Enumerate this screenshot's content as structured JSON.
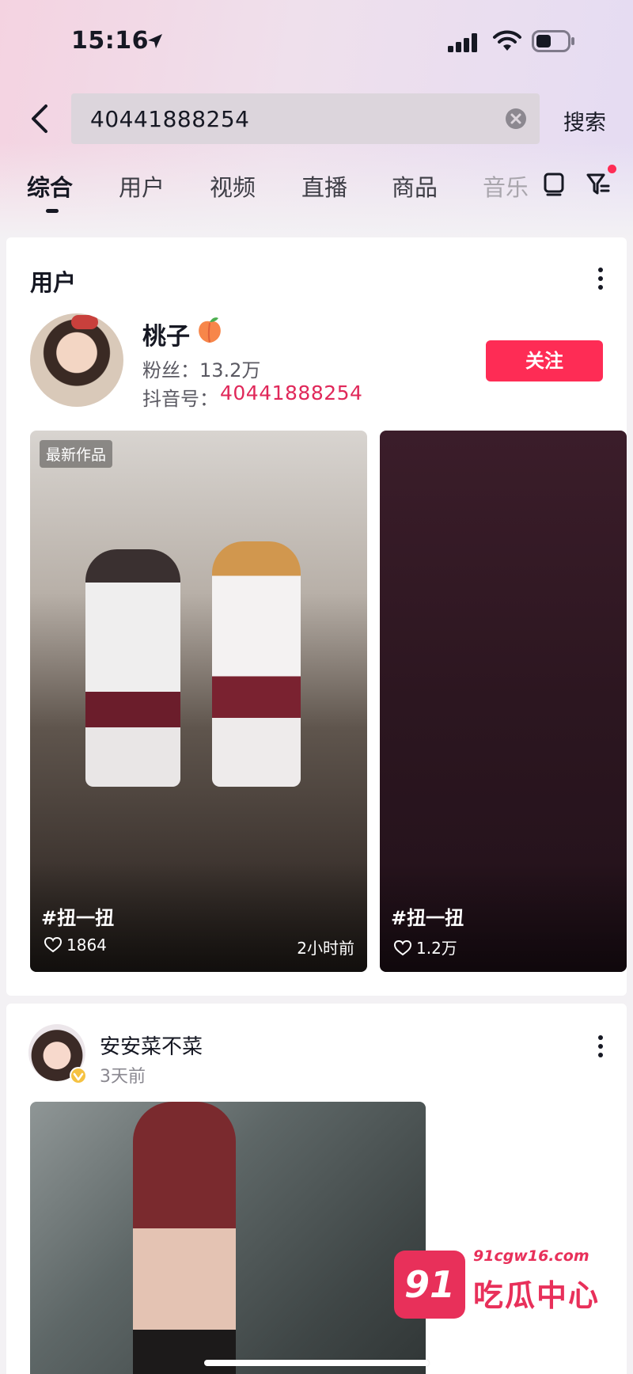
{
  "status_bar": {
    "time": "15:16"
  },
  "search": {
    "query": "40441888254",
    "submit_label": "搜索"
  },
  "tabs": [
    {
      "label": "综合"
    },
    {
      "label": "用户"
    },
    {
      "label": "视频"
    },
    {
      "label": "直播"
    },
    {
      "label": "商品"
    },
    {
      "label": "音乐"
    }
  ],
  "user_card": {
    "section_title": "用户",
    "name": "桃子",
    "fans": "粉丝：13.2万",
    "id_label": "抖音号：",
    "id_value": "40441888254",
    "follow_label": "关注",
    "videos": [
      {
        "badge": "最新作品",
        "tag": "#扭一扭",
        "likes": "1864",
        "time": "2小时前"
      },
      {
        "tag": "#扭一扭",
        "likes": "1.2万"
      }
    ]
  },
  "post": {
    "user": "安安菜不菜",
    "time": "3天前"
  },
  "watermark": {
    "badge": "91",
    "domain": "91cgw16.com",
    "name": "吃瓜中心"
  },
  "colors": {
    "accent": "#fe2c55",
    "id_pink": "#e0285a"
  },
  "icons": [
    "location-arrow-icon",
    "signal-icon",
    "wifi-icon",
    "battery-icon",
    "back-icon",
    "clear-icon",
    "layout-icon",
    "filter-icon",
    "more-icon",
    "peach-icon",
    "heart-icon",
    "verified-icon"
  ]
}
